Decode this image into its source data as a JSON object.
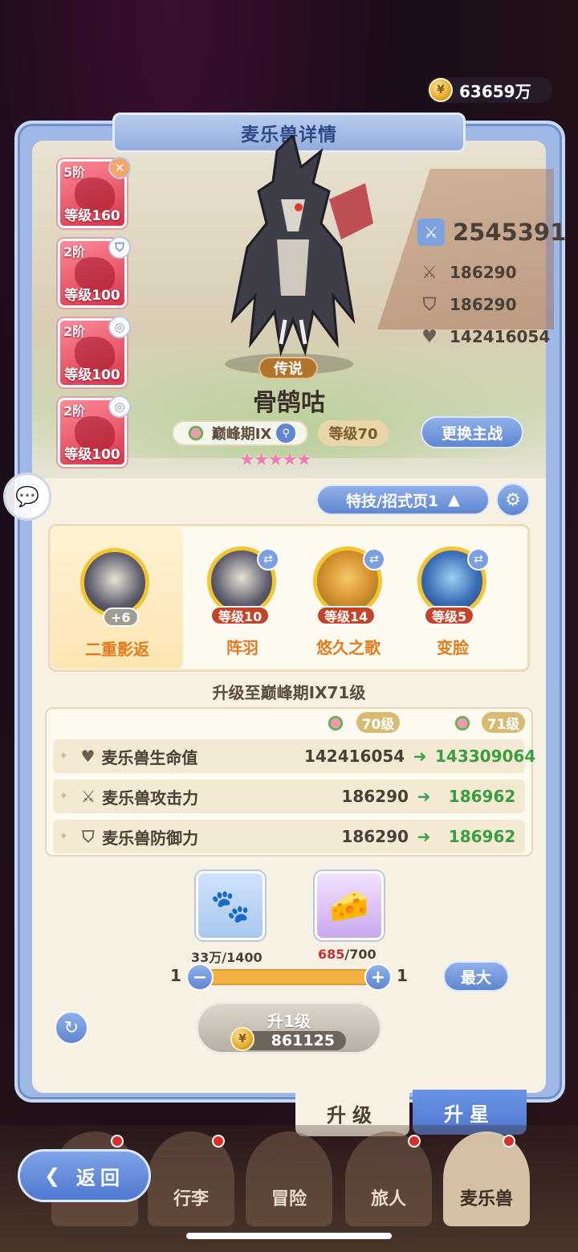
{
  "currency": {
    "amount": "63659万"
  },
  "title": "麦乐兽详情",
  "skills": [
    {
      "rank": "5阶",
      "level": "等级160",
      "badge_icon": "x-icon",
      "badge": "✕"
    },
    {
      "rank": "2阶",
      "level": "等级100",
      "badge_icon": "shield-icon",
      "badge": "⛉"
    },
    {
      "rank": "2阶",
      "level": "等级100",
      "badge_icon": "swirl-icon",
      "badge": "◎"
    },
    {
      "rank": "2阶",
      "level": "等级100",
      "badge_icon": "swirl-icon",
      "badge": "◎"
    }
  ],
  "power": {
    "total": "2545391",
    "attack": "186290",
    "defense": "186290",
    "hp": "142416054"
  },
  "beast": {
    "rarity": "传说",
    "name": "骨鹄咕",
    "stage": "巅峰期IX",
    "level": "等级70",
    "stars": "★★★★★",
    "swap_label": "更换主战"
  },
  "move_page": {
    "label": "特技/招式页1"
  },
  "moves": [
    {
      "name": "二重影返",
      "bonus": "+6"
    },
    {
      "name": "阵羽",
      "level": "等级10"
    },
    {
      "name": "悠久之歌",
      "level": "等级14"
    },
    {
      "name": "变脸",
      "level": "等级5"
    }
  ],
  "upgrade": {
    "title": "升级至巅峰期IX71级",
    "from_level": "70级",
    "to_level": "71级",
    "rows": [
      {
        "icon": "heart-icon",
        "label": "麦乐兽生命值",
        "current": "142416054",
        "next": "143309064"
      },
      {
        "icon": "swords-icon",
        "label": "麦乐兽攻击力",
        "current": "186290",
        "next": "186962"
      },
      {
        "icon": "shield-icon",
        "label": "麦乐兽防御力",
        "current": "186290",
        "next": "186962"
      }
    ]
  },
  "items": [
    {
      "name": "food-bag",
      "count": "33万/1400"
    },
    {
      "name": "cheese",
      "count_have": "685",
      "count_need": "/700"
    }
  ],
  "slider": {
    "min": "1",
    "max": "1",
    "max_label": "最大"
  },
  "level_up": {
    "label": "升1级",
    "cost": "861125"
  },
  "tabs": {
    "level_up": "升级",
    "star_up": "升星"
  },
  "nav": {
    "back": "返回",
    "items": [
      "行李",
      "冒险",
      "旅人",
      "麦乐兽"
    ]
  },
  "colors": {
    "accent": "#5f86cf",
    "legend": "#b0752c",
    "increase": "#3a9d3f"
  }
}
